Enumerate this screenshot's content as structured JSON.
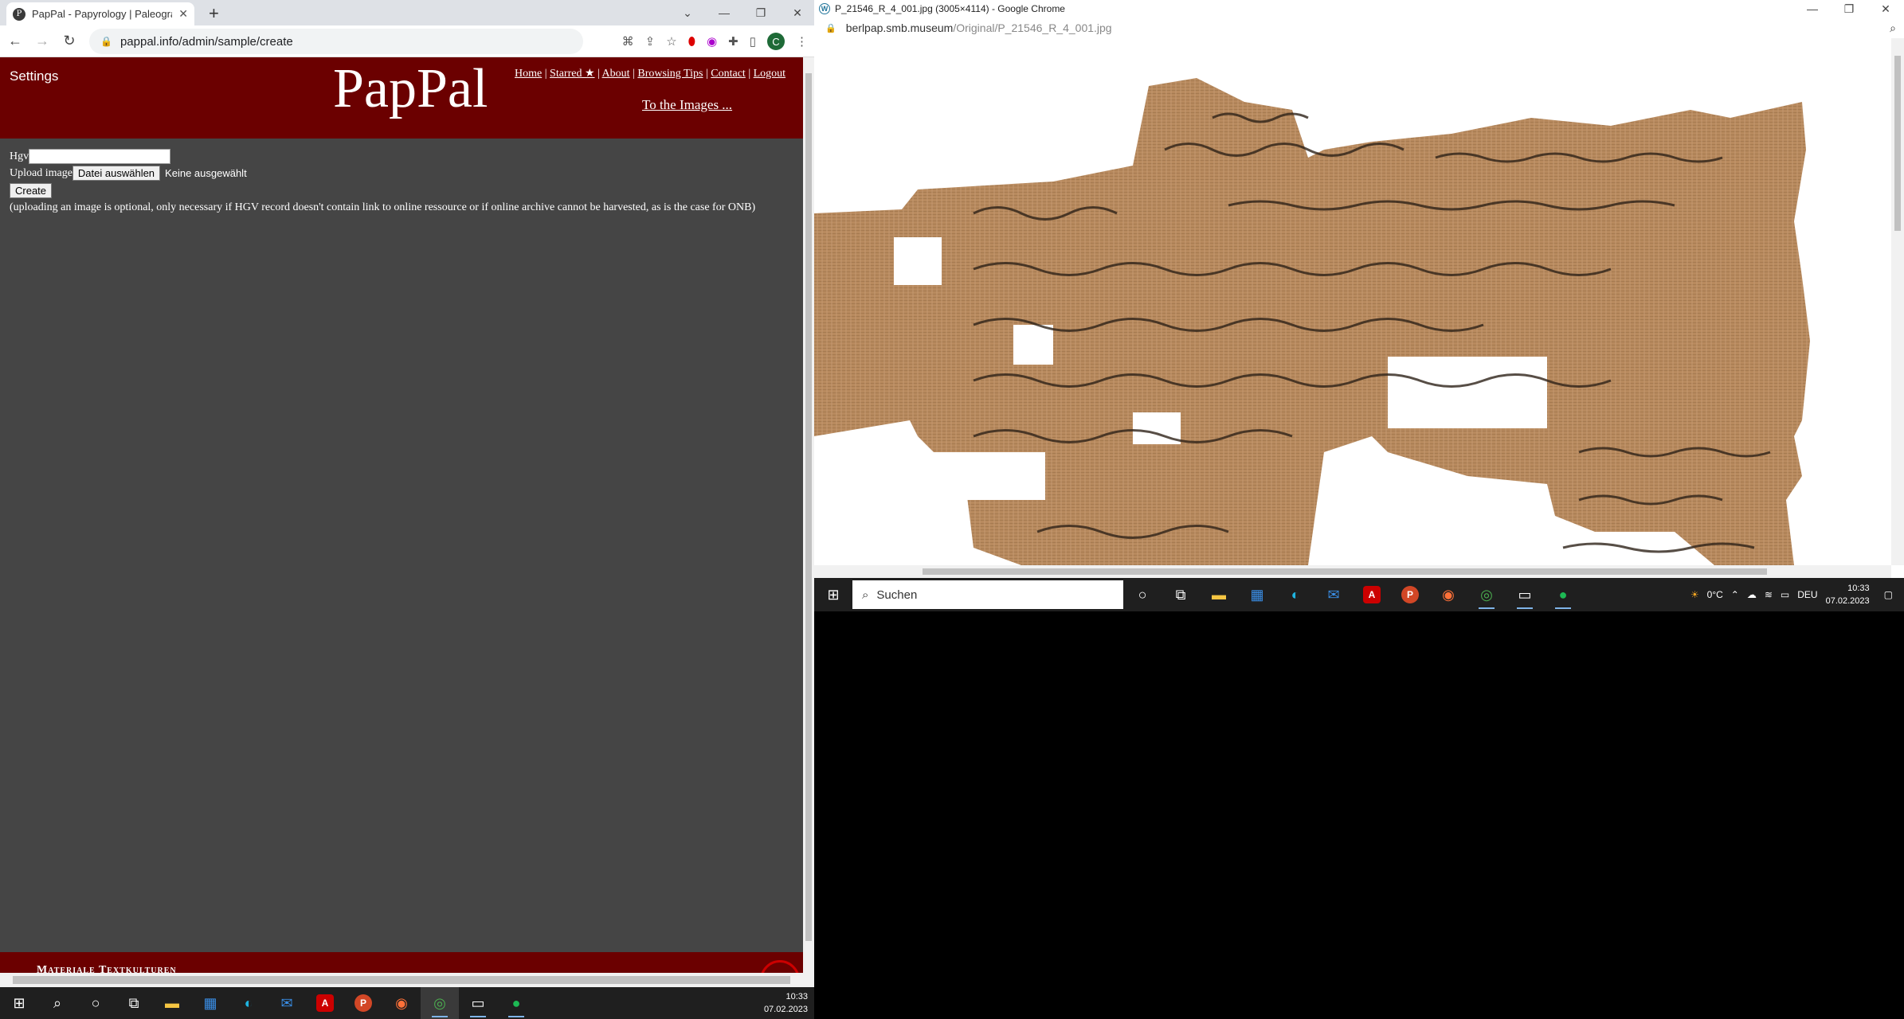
{
  "left_browser": {
    "tab_title": "PapPal - Papyrology | Paleograph",
    "tab_favicon": "P",
    "url": "pappal.info/admin/sample/create",
    "avatar_letter": "C"
  },
  "pappal": {
    "settings": "Settings",
    "logo": "PapPal",
    "nav": {
      "home": "Home",
      "starred": "Starred ★",
      "about": "About",
      "browsing_tips": "Browsing Tips",
      "contact": "Contact",
      "logout": "Logout"
    },
    "to_images": "To the Images ...",
    "form": {
      "hgv_label": "Hgv",
      "hgv_value": "",
      "upload_label": "Upload image",
      "file_button": "Datei auswählen",
      "file_status": "Keine ausgewählt",
      "create_button": "Create",
      "note": "(uploading an image is optional, only necessary if HGV record doesn't contain link to online ressource or if online archive cannot be harvested, as is the case for ONB)"
    },
    "footer_text": "Materiale Textkulturen"
  },
  "right_browser": {
    "window_title": "P_21546_R_4_001.jpg (3005×4114) - Google Chrome",
    "url_host": "berlpap.smb.museum",
    "url_path": "/Original/P_21546_R_4_001.jpg"
  },
  "taskbar_small": {
    "search_placeholder": "Suchen",
    "weather": "0°C",
    "lang": "DEU",
    "time": "10:33",
    "date": "07.02.2023"
  },
  "taskbar_big": {
    "time": "10:33",
    "date": "07.02.2023"
  }
}
